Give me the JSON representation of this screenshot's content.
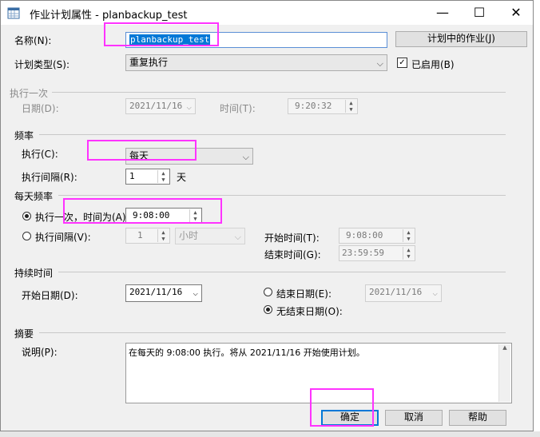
{
  "window": {
    "title": "作业计划属性 - planbackup_test",
    "minimize": "—",
    "maximize": "☐",
    "close": "✕"
  },
  "name": {
    "label": "名称(N):",
    "value": "planbackup_test",
    "jobs_button": "计划中的作业(J)"
  },
  "schedule_type": {
    "label": "计划类型(S):",
    "value": "重复执行",
    "enabled_label": "已启用(B)",
    "enabled": true
  },
  "once": {
    "heading": "执行一次",
    "date_label": "日期(D):",
    "date_value": "2021/11/16",
    "time_label": "时间(T):",
    "time_value": "9:20:32"
  },
  "frequency": {
    "heading": "频率",
    "occurs_label": "执行(C):",
    "occurs_value": "每天",
    "recurs_label": "执行间隔(R):",
    "recurs_value": "1",
    "recurs_unit": "天"
  },
  "daily": {
    "heading": "每天频率",
    "once_label": "执行一次，时间为(A):",
    "once_time": "9:08:00",
    "once_selected": true,
    "every_label": "执行间隔(V):",
    "every_value": "1",
    "every_unit": "小时",
    "start_label": "开始时间(T):",
    "start_value": "9:08:00",
    "end_label": "结束时间(G):",
    "end_value": "23:59:59"
  },
  "duration": {
    "heading": "持续时间",
    "start_label": "开始日期(D):",
    "start_value": "2021/11/16",
    "end_date_label": "结束日期(E):",
    "end_date_value": "2021/11/16",
    "no_end_label": "无结束日期(O):",
    "no_end_selected": true
  },
  "summary": {
    "heading": "摘要",
    "desc_label": "说明(P):",
    "desc_value": "在每天的 9:08:00 执行。将从 2021/11/16 开始使用计划。"
  },
  "buttons": {
    "ok": "确定",
    "cancel": "取消",
    "help": "帮助"
  },
  "colors": {
    "highlight": "#ff33ff",
    "selection": "#0078d7"
  }
}
